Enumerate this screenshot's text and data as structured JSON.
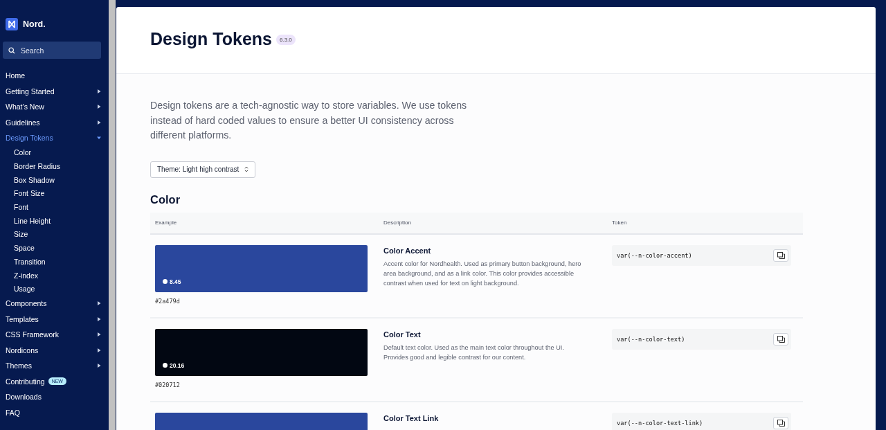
{
  "sidebar": {
    "logo": "Nord.",
    "search": {
      "placeholder": "Search"
    },
    "items": [
      {
        "kind": "link",
        "label": "Home",
        "selected": false
      },
      {
        "kind": "group",
        "label": "Getting Started",
        "selected": false,
        "expanded": false
      },
      {
        "kind": "group",
        "label": "What’s New",
        "selected": false,
        "expanded": false
      },
      {
        "kind": "group",
        "label": "Guidelines",
        "selected": false,
        "expanded": false
      },
      {
        "kind": "group",
        "label": "Design Tokens",
        "selected": true,
        "expanded": true,
        "children": [
          {
            "label": "Color"
          },
          {
            "label": "Border Radius"
          },
          {
            "label": "Box Shadow"
          },
          {
            "label": "Font Size"
          },
          {
            "label": "Font"
          },
          {
            "label": "Line Height"
          },
          {
            "label": "Size"
          },
          {
            "label": "Space"
          },
          {
            "label": "Transition"
          },
          {
            "label": "Z-index"
          },
          {
            "label": "Usage"
          }
        ]
      },
      {
        "kind": "group",
        "label": "Components",
        "selected": false,
        "expanded": false
      },
      {
        "kind": "group",
        "label": "Templates",
        "selected": false,
        "expanded": false
      },
      {
        "kind": "group",
        "label": "CSS Framework",
        "selected": false,
        "expanded": false
      },
      {
        "kind": "group",
        "label": "Nordicons",
        "selected": false,
        "expanded": false
      },
      {
        "kind": "group",
        "label": "Themes",
        "selected": false,
        "expanded": false
      },
      {
        "kind": "link",
        "label": "Contributing",
        "selected": false,
        "badge": "NEW"
      },
      {
        "kind": "link",
        "label": "Downloads",
        "selected": false
      },
      {
        "kind": "link",
        "label": "FAQ",
        "selected": false
      }
    ]
  },
  "page": {
    "title": "Design Tokens",
    "version": "6.3.0",
    "intro": "Design tokens are a tech-agnostic way to store variables. We use tokens instead of hard coded values to ensure a better UI consistency across different platforms.",
    "theme_select": {
      "value": "Theme: Light high contrast"
    },
    "section_title": "Color",
    "table": {
      "columns": [
        "Example",
        "Description",
        "Token"
      ],
      "rows": [
        {
          "color": "#2a479d",
          "contrast": "8.45",
          "hex": "#2a479d",
          "name": "Color Accent",
          "description": "Accent color for Nordhealth. Used as primary button background, hero area background, and as a link color. This color provides accessible contrast when used for text on light background.",
          "token": "var(--n-color-accent)"
        },
        {
          "color": "#020712",
          "contrast": "20.16",
          "hex": "#020712",
          "name": "Color Text",
          "description": "Default text color. Used as the main text color throughout the UI. Provides good and legible contrast for our content.",
          "token": "var(--n-color-text)"
        },
        {
          "color": "#2a479d",
          "name": "Color Text Link",
          "token": "var(--n-color-text-link)"
        }
      ]
    }
  }
}
